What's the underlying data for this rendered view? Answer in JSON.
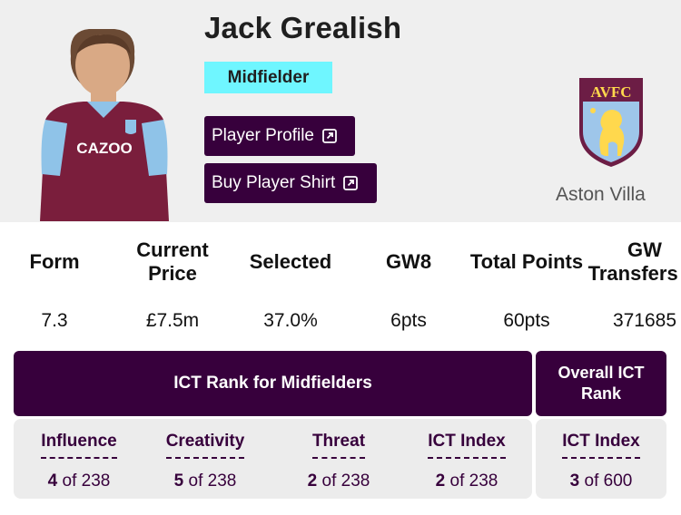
{
  "player": {
    "name": "Jack Grealish",
    "position": "Midfielder",
    "profile_label": "Player Profile",
    "shirt_label": "Buy Player Shirt",
    "club": "Aston Villa",
    "crest_text": "AVFC",
    "shirt_sponsor": "CAZOO",
    "shirt_color": "#7a1e3c",
    "sleeve_color": "#8fc3e8"
  },
  "colors": {
    "primary": "#37003c",
    "badge": "#6ff6ff",
    "hero_bg": "#efefef",
    "panel_bg": "#ececec"
  },
  "stats": [
    {
      "label": "Form",
      "value": "7.3"
    },
    {
      "label": "Current Price",
      "value": "£7.5m"
    },
    {
      "label": "Selected",
      "value": "37.0%"
    },
    {
      "label": "GW8",
      "value": "6pts"
    },
    {
      "label": "Total Points",
      "value": "60pts"
    },
    {
      "label": "GW Transfers In",
      "value": "371685"
    }
  ],
  "ict": {
    "title": "ICT Rank for Midfielders",
    "overall_title": "Overall ICT Rank",
    "of_text": "of",
    "ranks": [
      {
        "label": "Influence",
        "rank": "4",
        "total": "238"
      },
      {
        "label": "Creativity",
        "rank": "5",
        "total": "238"
      },
      {
        "label": "Threat",
        "rank": "2",
        "total": "238"
      },
      {
        "label": "ICT Index",
        "rank": "2",
        "total": "238"
      }
    ],
    "overall": {
      "label": "ICT Index",
      "rank": "3",
      "total": "600"
    }
  }
}
